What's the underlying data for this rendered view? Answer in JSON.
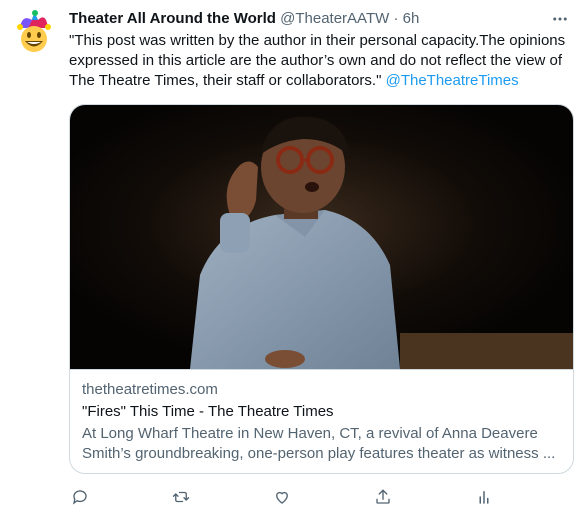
{
  "tweet": {
    "display_name": "Theater All Around the World",
    "handle": "@TheaterAATW",
    "separator": "·",
    "time": "6h",
    "text": "\"This post was written by the author in their personal capacity.The opinions expressed in this article are the author’s own and do not reflect the view of The Theatre Times, their staff or collaborators.\"",
    "mention": "@TheTheatreTimes",
    "avatar_icon": "jester-smiley-avatar",
    "more_icon": "more-horizontal-icon"
  },
  "card": {
    "domain": "thetheatretimes.com",
    "title": "\"Fires\" This Time - The Theatre Times",
    "description": "At Long Wharf Theatre in New Haven, CT, a revival of Anna Deavere Smith’s groundbreaking, one-person play features theater as witness ..."
  },
  "actions": {
    "icons": [
      "reply-icon",
      "retweet-icon",
      "like-icon",
      "share-icon",
      "analytics-icon"
    ]
  },
  "colors": {
    "text": "#0f1419",
    "secondary": "#536471",
    "link": "#1d9bf0",
    "border": "#cfd9de"
  }
}
